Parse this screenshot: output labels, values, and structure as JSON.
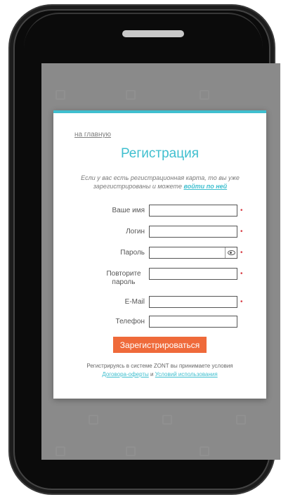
{
  "registration": {
    "home_link": "на главную",
    "title": "Регистрация",
    "hint_text": "Если у вас есть регистрационная карта, то вы уже зарегистрированы и можете",
    "hint_link": "войти по ней",
    "fields": {
      "name": {
        "label": "Ваше имя",
        "value": "",
        "required": "•"
      },
      "login": {
        "label": "Логин",
        "value": "",
        "required": "•"
      },
      "password": {
        "label": "Пароль",
        "value": "",
        "required": "•",
        "icon": "eye-icon"
      },
      "password_repeat": {
        "label": "Повторите пароль",
        "value": "",
        "required": "•"
      },
      "email": {
        "label": "E-Mail",
        "value": "",
        "required": "•"
      },
      "phone": {
        "label": "Телефон",
        "value": ""
      }
    },
    "submit_label": "Зарегистрироваться",
    "terms_text": "Регистрируясь в системе ZONT вы принимаете условия",
    "terms_link_offer": "Договора-оферты",
    "terms_and": "и",
    "terms_link_usage": "Условий использования"
  },
  "colors": {
    "accent": "#3fbfcf",
    "button": "#ef6a3a",
    "required": "#d9434b",
    "overlay": "#8a8a8a"
  }
}
